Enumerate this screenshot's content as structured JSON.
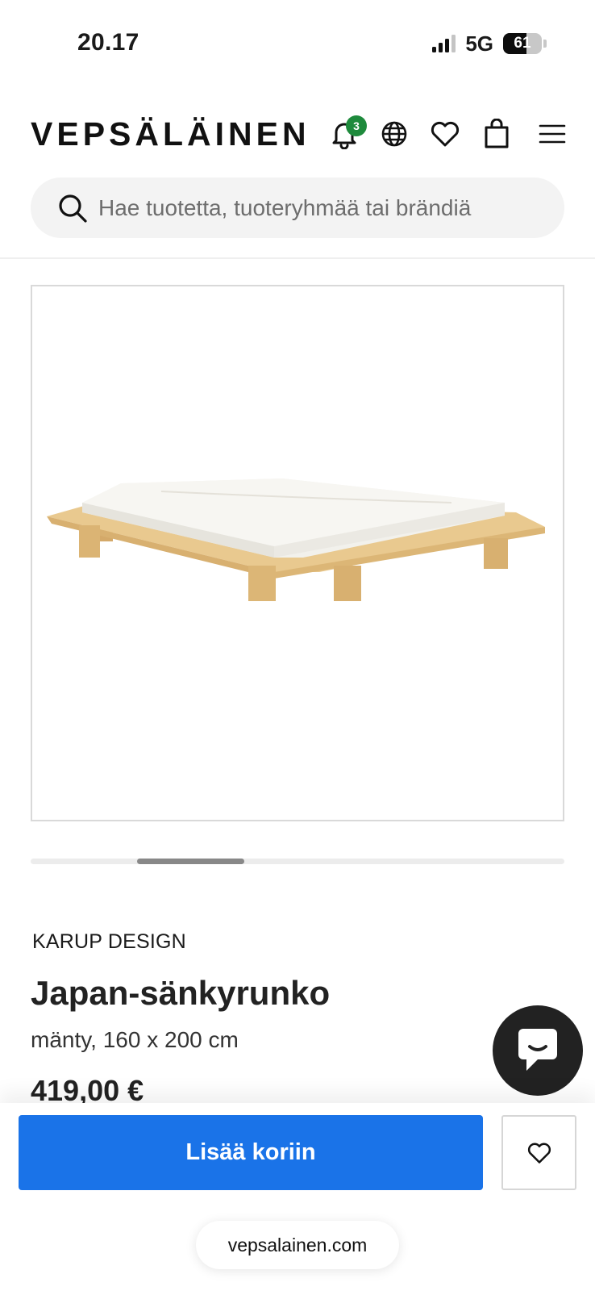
{
  "status_bar": {
    "time": "20.17",
    "network": "5G",
    "signal_bars_active": 3,
    "signal_bars_total": 4,
    "battery_level": "61",
    "battery_fraction": 0.61
  },
  "header": {
    "logo": "VEPSÄLÄINEN",
    "notification_count": "3",
    "icons": [
      "bell-icon",
      "globe-icon",
      "heart-icon",
      "shopping-bag-icon",
      "menu-icon"
    ]
  },
  "search": {
    "placeholder": "Hae tuotetta, tuoteryhmää tai brändiä"
  },
  "carousel": {
    "position_start": 0.2,
    "visible_fraction": 0.2
  },
  "product": {
    "brand": "KARUP DESIGN",
    "name": "Japan-sänkyrunko",
    "variant": "mänty, 160 x 200 cm",
    "price": "419,00 €"
  },
  "actions": {
    "add_to_cart": "Lisää koriin"
  },
  "browser": {
    "url": "vepsalainen.com"
  },
  "colors": {
    "primary_button": "#1a73e8",
    "badge": "#1e8a3c",
    "chat_button": "#222222"
  }
}
